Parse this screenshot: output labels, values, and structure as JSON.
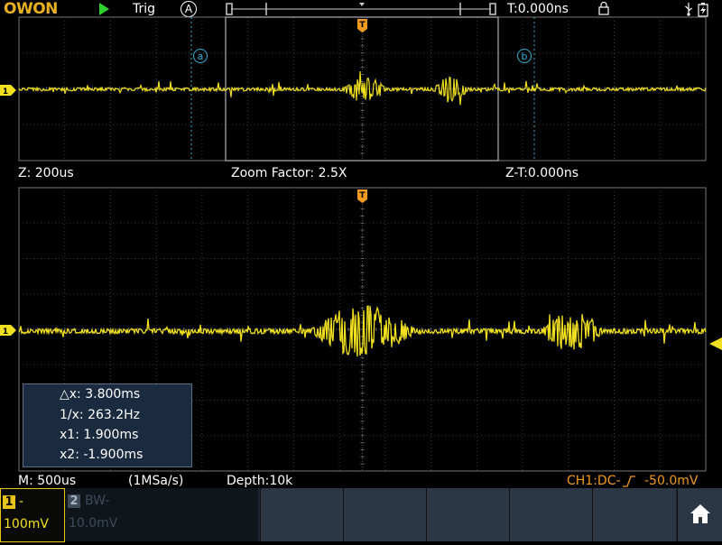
{
  "header": {
    "logo": "OWON",
    "trig_label": "Trig",
    "trig_source": "A",
    "time_position": "T:0.000ns"
  },
  "cursors": {
    "a_label": "a",
    "b_label": "b",
    "trigger_marker": "T"
  },
  "zoom_info": {
    "zoom_timebase": "Z: 200us",
    "zoom_factor": "Zoom Factor: 2.5X",
    "zoom_time": "Z-T:0.000ns"
  },
  "measurements": {
    "delta_x": "△x: 3.800ms",
    "inv_x": "1/x: 263.2Hz",
    "x1": "x1: 1.900ms",
    "x2": "x2: -1.900ms"
  },
  "status_bar": {
    "main_timebase": "M: 500us",
    "sample_rate": "(1MSa/s)",
    "depth": "Depth:10k",
    "trigger_info": "CH1:DC-",
    "trigger_level": "-50.0mV"
  },
  "channels": [
    {
      "number": "1",
      "coupling": "-",
      "scale": "100mV",
      "color": "#e8c41a"
    },
    {
      "number": "2",
      "coupling": "BW-",
      "scale": "10.0mV",
      "color": "#3d4a5a"
    }
  ],
  "colors": {
    "trace": "#f0e020",
    "grid": "#3a3a3a",
    "trigger": "#f19a22",
    "cursor": "#2bb3d6"
  }
}
